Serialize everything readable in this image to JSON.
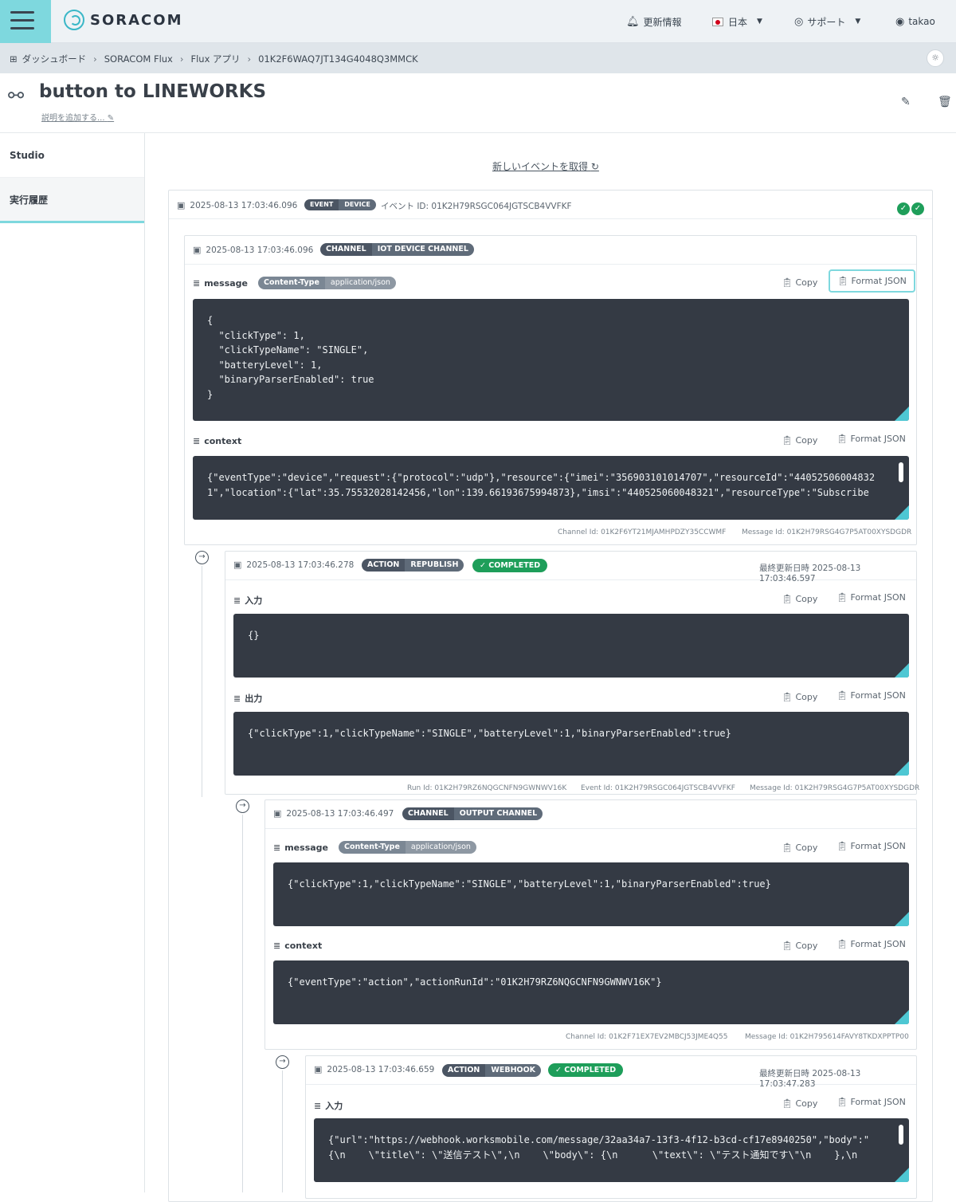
{
  "brand": {
    "name": "SORACOM",
    "accent": "#7ed8de",
    "success": "#1e9e5a",
    "code_bg": "#343a44"
  },
  "header": {
    "news": "更新情報",
    "language": "日本",
    "support": "サポート",
    "user": "takao"
  },
  "breadcrumb": [
    "ダッシュボード",
    "SORACOM Flux",
    "Flux アプリ",
    "01K2F6WAQ7JT134G4048Q3MMCK"
  ],
  "page": {
    "title": "button to LINEWORKS",
    "add_description": "説明を追加する..."
  },
  "sidebar": {
    "items": [
      {
        "label": "Studio"
      },
      {
        "label": "実行履歴"
      }
    ]
  },
  "refresh_label": "新しいイベントを取得",
  "labels": {
    "copy": "Copy",
    "format_json": "Format JSON",
    "message": "message",
    "context": "context",
    "input": "入力",
    "output": "出力",
    "last_updated": "最終更新日時",
    "completed": "COMPLETED"
  },
  "event": {
    "timestamp": "2025-08-13 17:03:46.096",
    "tag_a": "EVENT",
    "tag_b": "DEVICE",
    "event_id_text": "イベント ID: 01K2H79RSGC064JGTSCB4VVFKF"
  },
  "channel1": {
    "timestamp": "2025-08-13 17:03:46.096",
    "tag_a": "CHANNEL",
    "tag_b": "IOT DEVICE CHANNEL",
    "content_type_key": "Content-Type",
    "content_type_val": "application/json",
    "message": "{\n  \"clickType\": 1,\n  \"clickTypeName\": \"SINGLE\",\n  \"batteryLevel\": 1,\n  \"binaryParserEnabled\": true\n}",
    "context": "{\"eventType\":\"device\",\"request\":{\"protocol\":\"udp\"},\"resource\":{\"imei\":\"356903101014707\",\"resourceId\":\"440525060048321\",\"location\":{\"lat\":35.75532028142456,\"lon\":139.66193675994873},\"imsi\":\"440525060048321\",\"resourceType\":\"Subscribe",
    "channel_id": "Channel Id: 01K2F6YT21MJAMHPDZY35CCWMF",
    "message_id": "Message Id: 01K2H79RSG4G7P5AT00XYSDGDR"
  },
  "action1": {
    "timestamp": "2025-08-13 17:03:46.278",
    "tag_a": "ACTION",
    "tag_b": "REPUBLISH",
    "updated": "2025-08-13 17:03:46.597",
    "input": "{}",
    "output": "{\"clickType\":1,\"clickTypeName\":\"SINGLE\",\"batteryLevel\":1,\"binaryParserEnabled\":true}",
    "run_id": "Run Id: 01K2H79RZ6NQGCNFN9GWNWV16K",
    "event_id": "Event Id: 01K2H79RSGC064JGTSCB4VVFKF",
    "message_id": "Message Id: 01K2H79RSG4G7P5AT00XYSDGDR"
  },
  "channel2": {
    "timestamp": "2025-08-13 17:03:46.497",
    "tag_a": "CHANNEL",
    "tag_b": "OUTPUT CHANNEL",
    "content_type_key": "Content-Type",
    "content_type_val": "application/json",
    "message": "{\"clickType\":1,\"clickTypeName\":\"SINGLE\",\"batteryLevel\":1,\"binaryParserEnabled\":true}",
    "context": "{\"eventType\":\"action\",\"actionRunId\":\"01K2H79RZ6NQGCNFN9GWNWV16K\"}",
    "channel_id": "Channel Id: 01K2F71EX7EV2MBCJ53JME4Q55",
    "message_id": "Message Id: 01K2H795614FAVY8TKDXPPTP00"
  },
  "action2": {
    "timestamp": "2025-08-13 17:03:46.659",
    "tag_a": "ACTION",
    "tag_b": "WEBHOOK",
    "updated": "2025-08-13 17:03:47.283",
    "input": "{\"url\":\"https://webhook.worksmobile.com/message/32aa34a7-13f3-4f12-b3cd-cf17e8940250\",\"body\":\"{\\n    \\\"title\\\": \\\"送信テスト\\\",\\n    \\\"body\\\": {\\n      \\\"text\\\": \\\"テスト通知です\\\"\\n    },\\n"
  }
}
